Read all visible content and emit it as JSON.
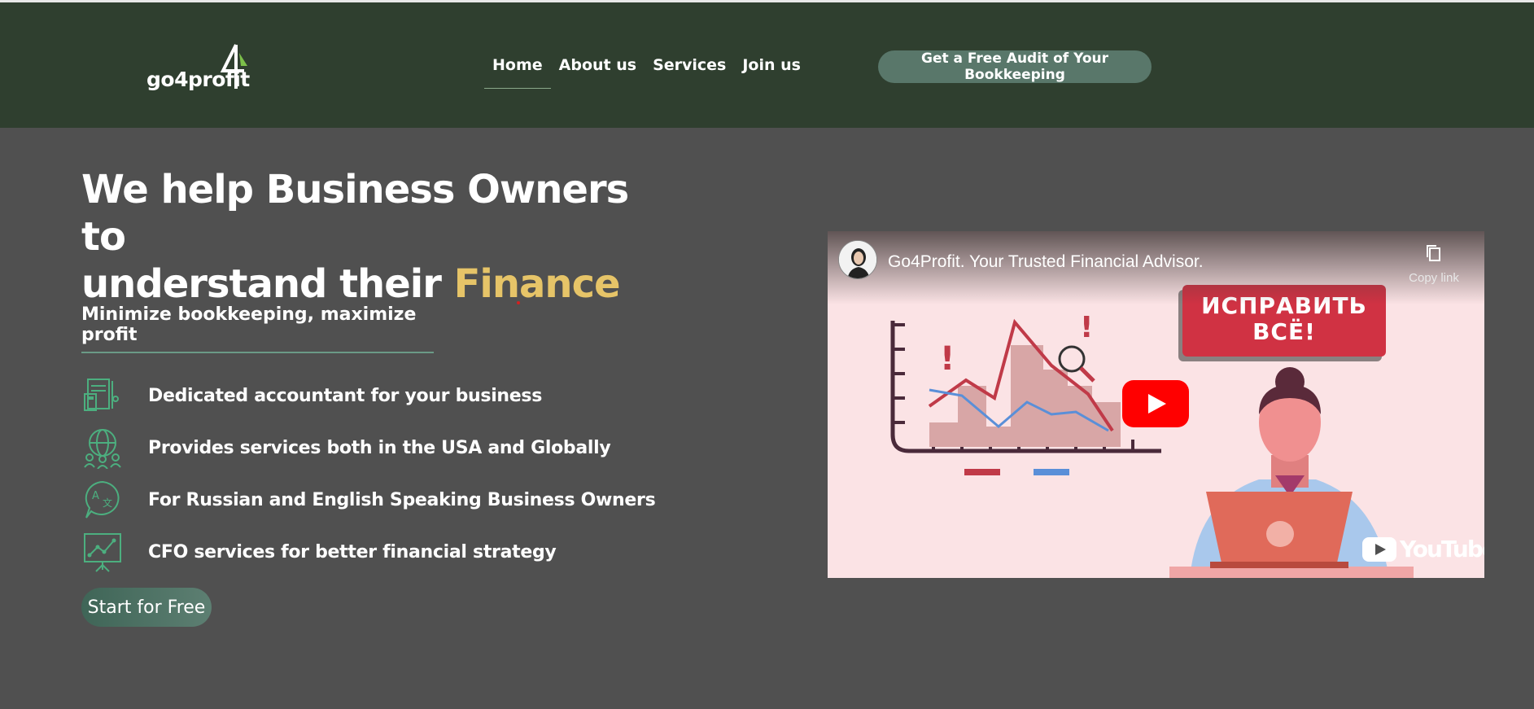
{
  "header": {
    "logo_text": "go4profit",
    "nav": [
      {
        "label": "Home",
        "active": true
      },
      {
        "label": "About us",
        "active": false
      },
      {
        "label": "Services",
        "active": false
      },
      {
        "label": "Join us",
        "active": false
      }
    ],
    "cta_label": "Get a Free Audit of Your Bookkeeping"
  },
  "hero": {
    "headline_line1": "We help Business Owners to",
    "headline_line2_prefix": "understand their ",
    "headline_accent": "Finance",
    "subhead": "Minimize bookkeeping, maximize profit",
    "features": [
      {
        "icon": "document-calculator-icon",
        "text": "Dedicated accountant for your business"
      },
      {
        "icon": "globe-people-icon",
        "text": "Provides services both in the USA and Globally"
      },
      {
        "icon": "translate-bubble-icon",
        "text": "For Russian and English Speaking Business Owners"
      },
      {
        "icon": "chart-presentation-icon",
        "text": "CFO services for better financial strategy"
      }
    ],
    "start_button": "Start for Free"
  },
  "video": {
    "title": "Go4Profit. Your Trusted Financial Advisor.",
    "copy_link_label": "Copy link",
    "sign_text_line1": "ИСПРАВИТЬ",
    "sign_text_line2": "ВСЁ!",
    "youtube_label": "YouTube"
  },
  "colors": {
    "header_bg": "#2f3f2f",
    "page_bg": "#505050",
    "accent_gold": "#e6c468",
    "button_green": "#59776a",
    "icon_green": "#4caf7f"
  }
}
